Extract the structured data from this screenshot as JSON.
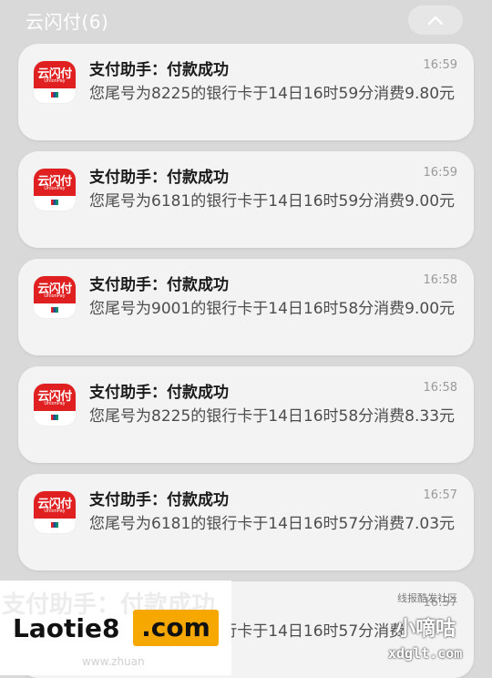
{
  "header": {
    "title": "云闪付(6)"
  },
  "icon": {
    "logo": "云闪付",
    "sub": "UnionPay"
  },
  "notifications": [
    {
      "title": "支付助手：付款成功",
      "time": "16:59",
      "body": "您尾号为8225的银行卡于14日16时59分消费9.80元"
    },
    {
      "title": "支付助手：付款成功",
      "time": "16:59",
      "body": "您尾号为6181的银行卡于14日16时59分消费9.00元"
    },
    {
      "title": "支付助手：付款成功",
      "time": "16:58",
      "body": "您尾号为9001的银行卡于14日16时58分消费9.00元"
    },
    {
      "title": "支付助手：付款成功",
      "time": "16:58",
      "body": "您尾号为8225的银行卡于14日16时58分消费8.33元"
    },
    {
      "title": "支付助手：付款成功",
      "time": "16:57",
      "body": "您尾号为6181的银行卡于14日16时57分消费7.03元"
    },
    {
      "title": "支付助手：付款成功",
      "time": "16:57",
      "body": "您尾号为8225的银行卡于14日16时57分消费"
    }
  ],
  "watermarks": {
    "left_main": "Laotie8",
    "left_com": ".com",
    "left_url": "www.zhuan",
    "right_small": "线报酷发社区",
    "right_big": "小嘀咕",
    "right_url": "xdglt.com"
  },
  "colors": {
    "brand_red": "#e02020",
    "card_bg": "#f3f3f3",
    "background": "#d9d9d9",
    "watermark_orange": "#f6a800"
  }
}
